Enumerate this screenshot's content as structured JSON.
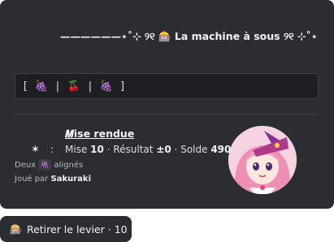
{
  "embed": {
    "title": "——————⋆˚⊹ ୨୧ 🎰 La machine à sous ୨୧ ⊹˚⋆",
    "slots": [
      "[",
      "🍇",
      "|",
      "🍒",
      "|",
      "🍇",
      "]"
    ],
    "heading": "𝑴ise rendue",
    "star": "✶",
    "colon": ":",
    "stats": {
      "mise_label": "Mise",
      "mise_value": "10",
      "sep1": "·",
      "resultat_label": "Résultat",
      "resultat_value": "±0",
      "sep2": "·",
      "solde_label": "Solde",
      "solde_value": "490",
      "solde_icon": "🐦"
    },
    "aligned": {
      "prefix": "Deux",
      "emoji": "🍇",
      "suffix": "alignés"
    },
    "played_by": {
      "prefix": "Joué par",
      "user": "Sakuraki"
    },
    "avatar_icon": "anime-girl-avatar"
  },
  "button": {
    "icon": "🎰",
    "label": "Retirer le levier · 10"
  }
}
